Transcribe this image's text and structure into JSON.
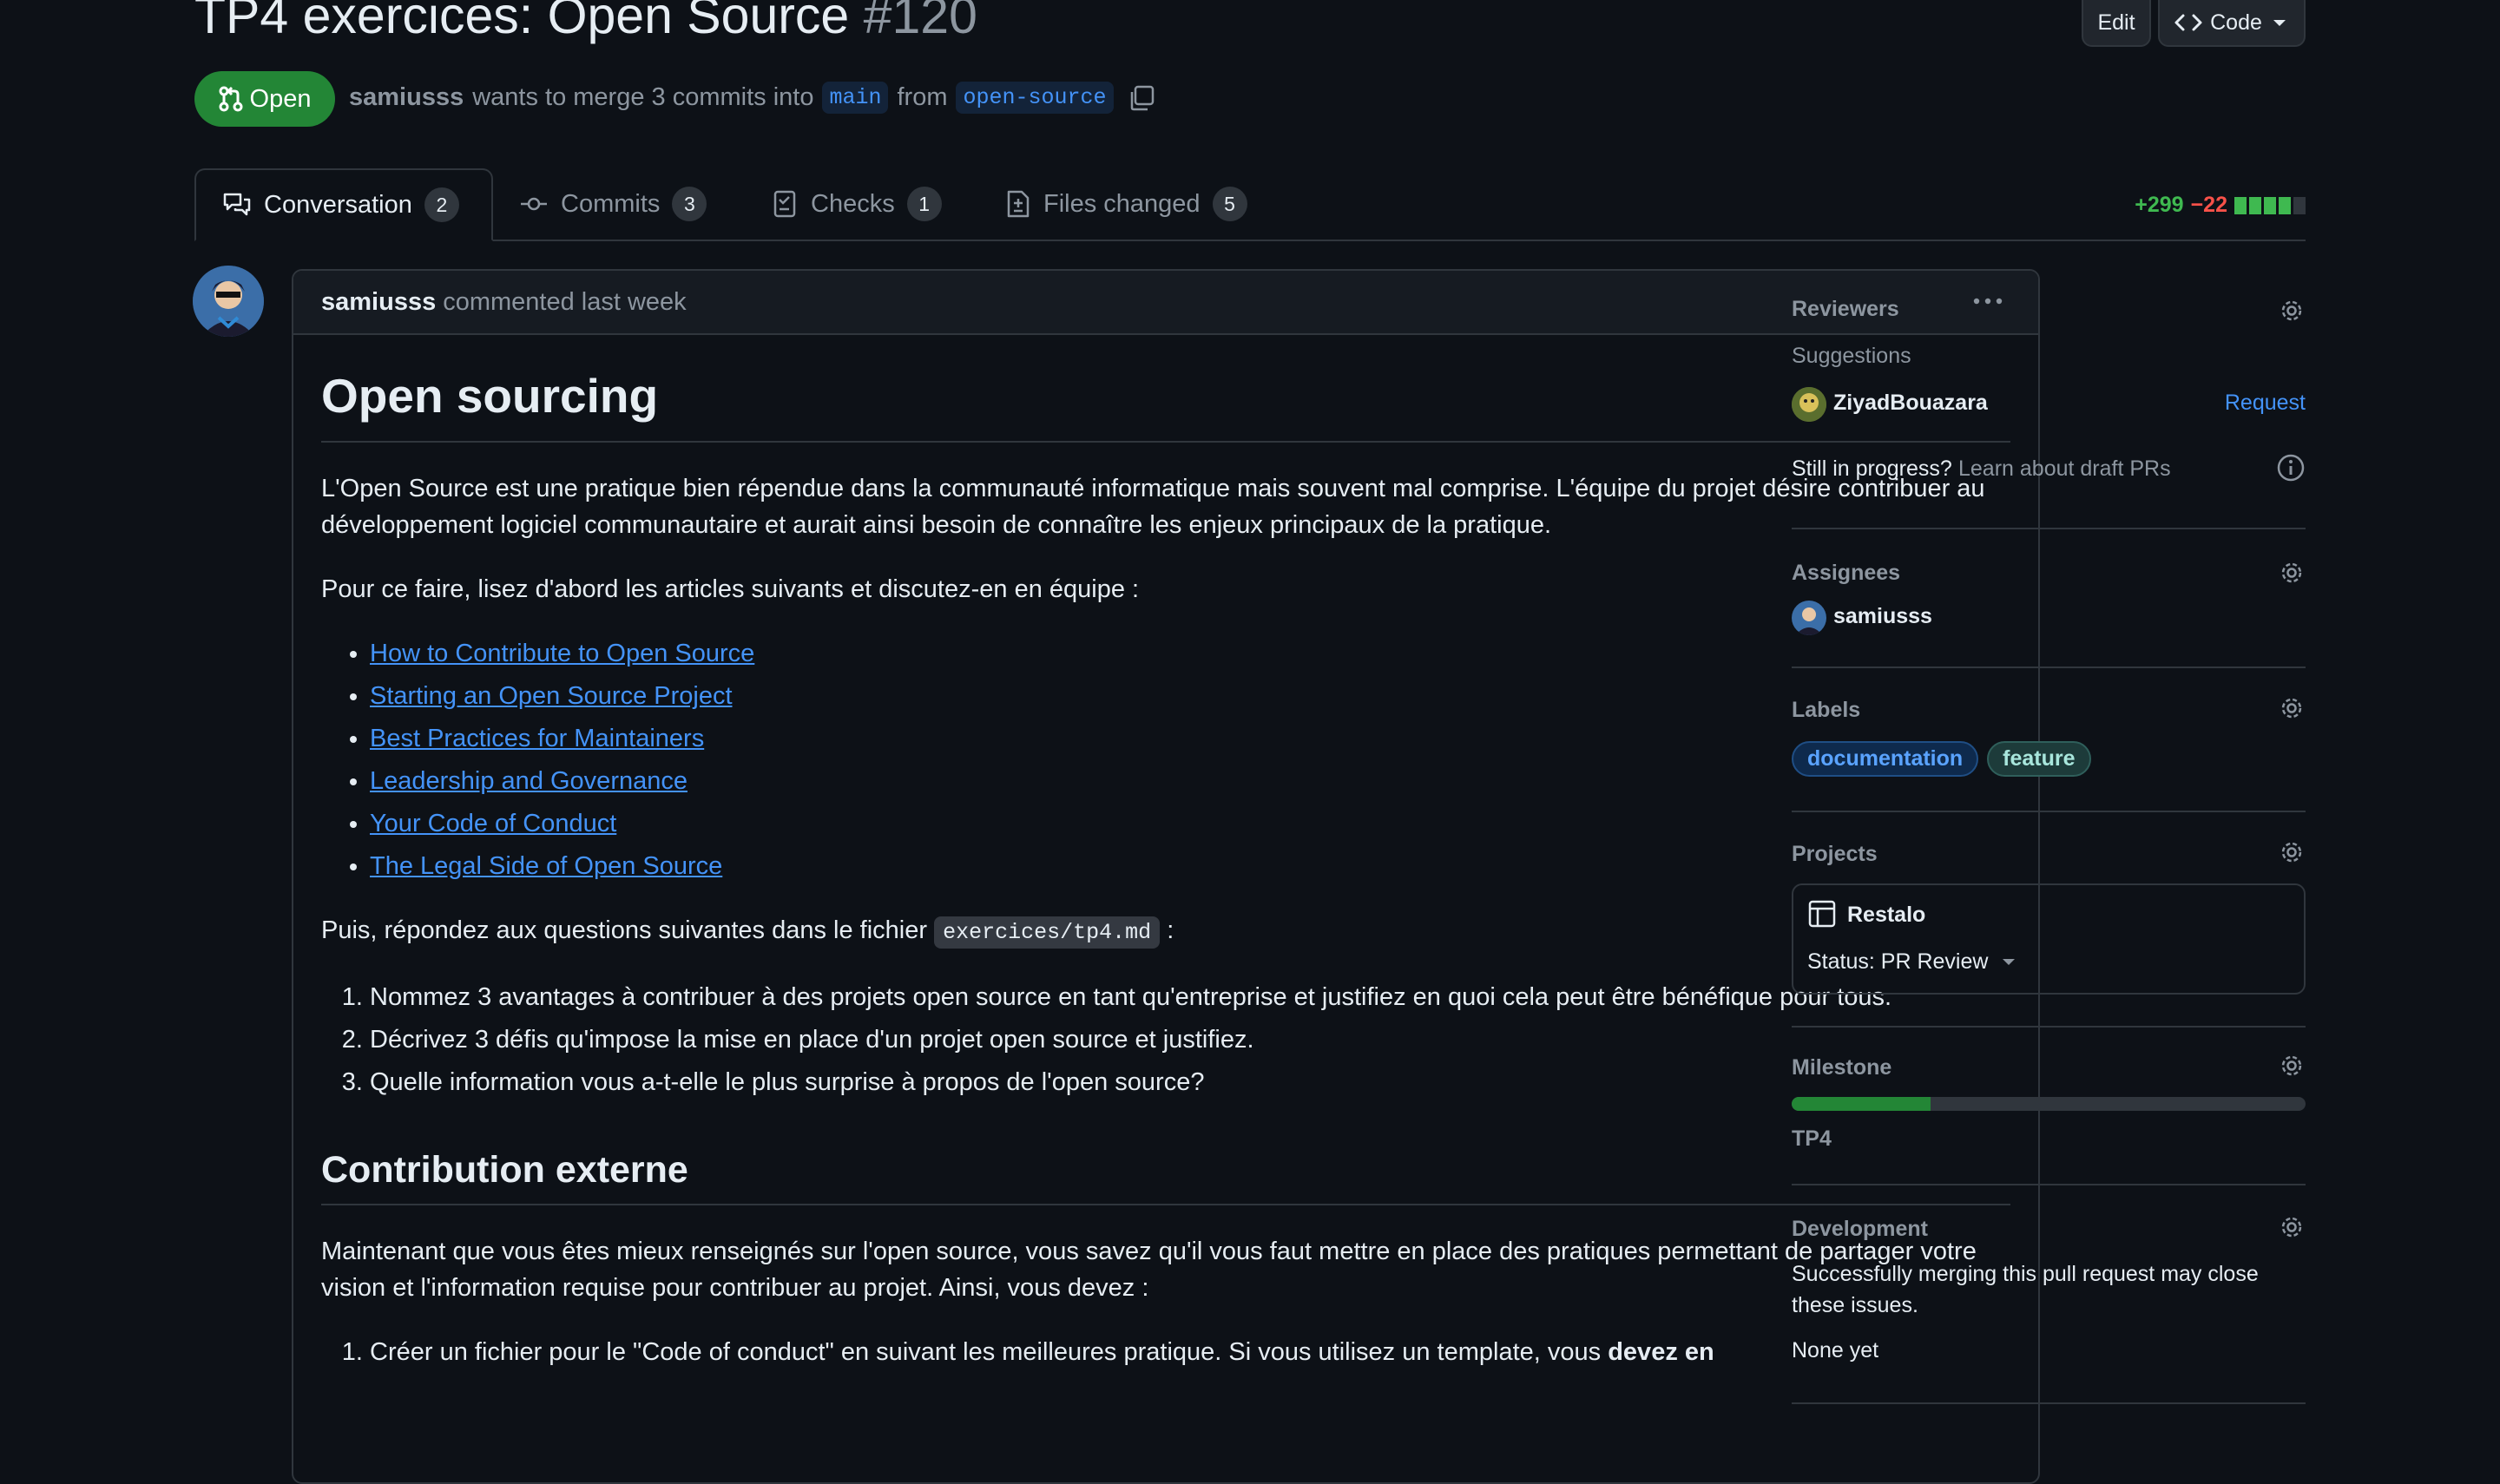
{
  "pr": {
    "title": "TP4 exercices: Open Source",
    "number": "#120",
    "state": "Open",
    "author": "samiusss",
    "merge_text": "wants to merge 3 commits into",
    "base_branch": "main",
    "from_text": "from",
    "head_branch": "open-source"
  },
  "header_actions": {
    "edit": "Edit",
    "code": "Code"
  },
  "tabs": [
    {
      "label": "Conversation",
      "count": "2"
    },
    {
      "label": "Commits",
      "count": "3"
    },
    {
      "label": "Checks",
      "count": "1"
    },
    {
      "label": "Files changed",
      "count": "5"
    }
  ],
  "diffstat": {
    "additions": "+299",
    "deletions": "−22"
  },
  "comment": {
    "author": "samiusss",
    "meta": "commented last week",
    "h1": "Open sourcing",
    "p1": "L'Open Source est une pratique bien répendue dans la communauté informatique mais souvent mal comprise. L'équipe du projet désire contribuer au développement logiciel communautaire et aurait ainsi besoin de connaître les enjeux principaux de la pratique.",
    "p2": "Pour ce faire, lisez d'abord les articles suivants et discutez-en en équipe :",
    "links": [
      "How to Contribute to Open Source",
      "Starting an Open Source Project",
      "Best Practices for Maintainers",
      "Leadership and Governance",
      "Your Code of Conduct",
      "The Legal Side of Open Source"
    ],
    "p3_before": "Puis, répondez aux questions suivantes dans le fichier",
    "p3_code": "exercices/tp4.md",
    "p3_after": ":",
    "questions": [
      "Nommez 3 avantages à contribuer à des projets open source en tant qu'entreprise et justifiez en quoi cela peut être bénéfique pour tous.",
      "Décrivez 3 défis qu'impose la mise en place d'un projet open source et justifiez.",
      "Quelle information vous a-t-elle le plus surprise à propos de l'open source?"
    ],
    "h2": "Contribution externe",
    "p4": "Maintenant que vous êtes mieux renseignés sur l'open source, vous savez qu'il vous faut mettre en place des pratiques permettant de partager votre vision et l'information requise pour contribuer au projet. Ainsi, vous devez :",
    "task1": "Créer un fichier pour le \"Code of conduct\" en suivant les meilleures pratique. Si vous utilisez un template, vous",
    "task1_bold": "devez en"
  },
  "sidebar": {
    "reviewers": {
      "title": "Reviewers",
      "suggestions": "Suggestions",
      "suggested_user": "ZiyadBouazara",
      "request": "Request",
      "draft_q": "Still in progress?",
      "draft_link": "Learn about draft PRs"
    },
    "assignees": {
      "title": "Assignees",
      "user": "samiusss"
    },
    "labels": {
      "title": "Labels",
      "items": [
        "documentation",
        "feature"
      ]
    },
    "projects": {
      "title": "Projects",
      "name": "Restalo",
      "status": "Status: PR Review"
    },
    "milestone": {
      "title": "Milestone",
      "name": "TP4",
      "progress": 0.27
    },
    "development": {
      "title": "Development",
      "text": "Successfully merging this pull request may close these issues.",
      "none": "None yet"
    }
  },
  "colors": {
    "open_green": "#238636",
    "accent_blue": "#4493f8",
    "additions": "#3fb950",
    "deletions": "#f85149"
  }
}
